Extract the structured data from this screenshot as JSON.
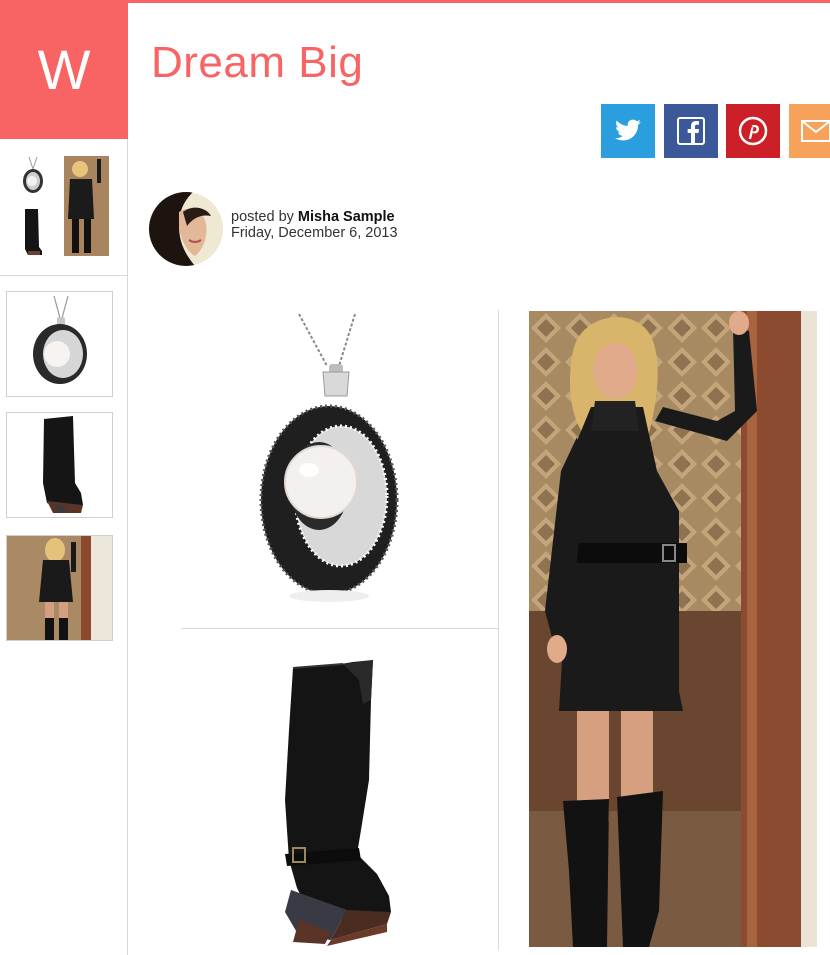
{
  "brand": {
    "logo_letter": "W",
    "accent_color": "#f86464"
  },
  "post": {
    "title": "Dream Big",
    "posted_by_prefix": "posted by",
    "author": "Misha Sample",
    "date": "Friday, December 6, 2013"
  },
  "share": {
    "buttons": [
      {
        "name": "twitter",
        "color": "#2b9ee0"
      },
      {
        "name": "facebook",
        "color": "#3b5998"
      },
      {
        "name": "pinterest",
        "color": "#cb2027"
      },
      {
        "name": "email",
        "color": "#f6a25a"
      }
    ]
  },
  "sidebar": {
    "thumbnails": [
      "pendant-necklace",
      "knee-high-boot",
      "model-in-sweater-dress"
    ]
  },
  "items": [
    "pendant-necklace",
    "knee-high-boot",
    "model-in-sweater-dress"
  ]
}
